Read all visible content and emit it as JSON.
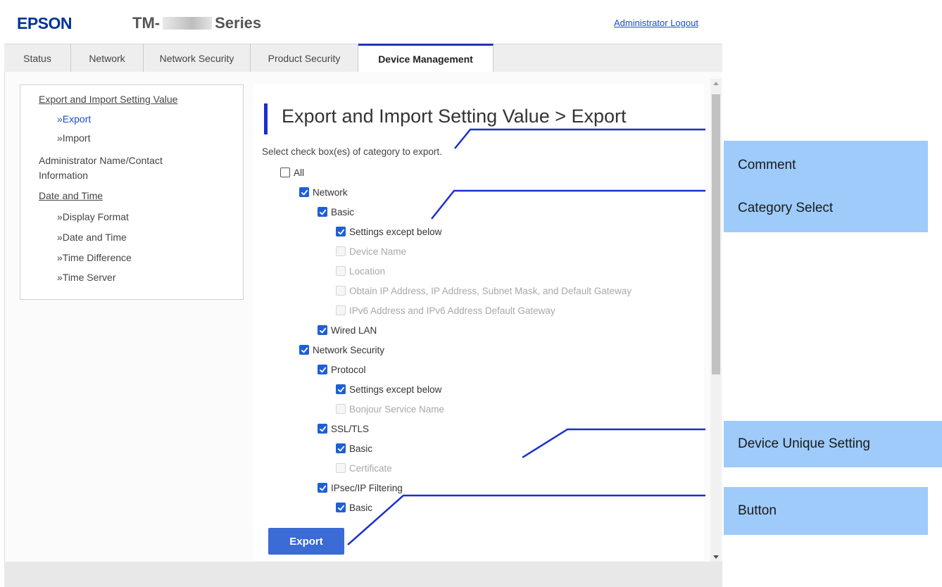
{
  "header": {
    "logo": "EPSON",
    "model_prefix": "TM-",
    "model_suffix": "Series",
    "logout_label": "Administrator Logout"
  },
  "tabs": [
    {
      "label": "Status",
      "active": false
    },
    {
      "label": "Network",
      "active": false
    },
    {
      "label": "Network Security",
      "active": false
    },
    {
      "label": "Product Security",
      "active": false
    },
    {
      "label": "Device Management",
      "active": true
    }
  ],
  "sidebar": {
    "items": [
      {
        "label": "Export and Import Setting Value",
        "type": "heading"
      },
      {
        "label": "»Export",
        "type": "link-active"
      },
      {
        "label": "»Import",
        "type": "link"
      },
      {
        "label": "Administrator Name/Contact",
        "type": "text"
      },
      {
        "label": "Information",
        "type": "text"
      },
      {
        "label": "Date and Time",
        "type": "heading"
      },
      {
        "label": "»Display Format",
        "type": "link"
      },
      {
        "label": "»Date and Time",
        "type": "link"
      },
      {
        "label": "»Time Difference",
        "type": "link"
      },
      {
        "label": "»Time Server",
        "type": "link"
      }
    ]
  },
  "main": {
    "title": "Export and Import Setting Value > Export",
    "prompt": "Select check box(es) of category to export.",
    "checkboxes": [
      {
        "label": "All",
        "state": "unchecked"
      },
      {
        "label": "Network",
        "state": "checked"
      },
      {
        "label": "Basic",
        "state": "checked"
      },
      {
        "label": "Settings except below",
        "state": "checked"
      },
      {
        "label": "Device Name",
        "state": "disabled"
      },
      {
        "label": "Location",
        "state": "disabled"
      },
      {
        "label": "Obtain IP Address, IP Address, Subnet Mask, and Default Gateway",
        "state": "disabled"
      },
      {
        "label": "IPv6 Address and IPv6 Address Default Gateway",
        "state": "disabled"
      },
      {
        "label": "Wired LAN",
        "state": "checked"
      },
      {
        "label": "Network Security",
        "state": "checked"
      },
      {
        "label": "Protocol",
        "state": "checked"
      },
      {
        "label": "Settings except below",
        "state": "checked"
      },
      {
        "label": "Bonjour Service Name",
        "state": "disabled"
      },
      {
        "label": "SSL/TLS",
        "state": "checked"
      },
      {
        "label": "Basic",
        "state": "checked"
      },
      {
        "label": "Certificate",
        "state": "disabled"
      },
      {
        "label": "IPsec/IP Filtering",
        "state": "checked"
      },
      {
        "label": "Basic",
        "state": "checked"
      }
    ],
    "export_label": "Export"
  },
  "callouts": [
    {
      "label": "Comment"
    },
    {
      "label": "Category Select"
    },
    {
      "label": "Device Unique Setting"
    },
    {
      "label": "Button"
    }
  ],
  "colors": {
    "accent": "#1a2fd0",
    "checkbox": "#1e5fd8",
    "callout": "#9ecbfa",
    "logo": "#003399"
  }
}
